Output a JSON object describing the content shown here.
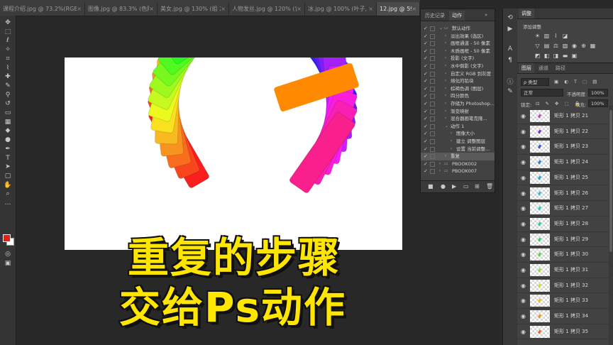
{
  "tabs": [
    {
      "label": "课程介绍.jpg @ 73.2%(RGB/...",
      "active": false
    },
    {
      "label": "图像.jpg @ 83.3% (色阶 1...",
      "active": false
    },
    {
      "label": "美女.jpg @ 130% (组 2, R...",
      "active": false
    },
    {
      "label": "人物发丝.jpg @ 120% (背景...",
      "active": false
    },
    {
      "label": "冰.jpg @ 100% (叶子, RGB...",
      "active": false
    },
    {
      "label": "12.jpg @ 59.6%",
      "active": true
    }
  ],
  "caption": {
    "line1": "重复的步骤",
    "line2": "交给Ps动作"
  },
  "actions_panel": {
    "tab_history": "历史记录",
    "tab_actions": "动作",
    "items": [
      {
        "label": "默认动作",
        "level": 0,
        "folder": true,
        "expanded": true
      },
      {
        "label": "淡出效果 (选区)",
        "level": 1
      },
      {
        "label": "画框通道 - 50 像素",
        "level": 1
      },
      {
        "label": "木质画框 - 50 像素",
        "level": 1
      },
      {
        "label": "投影 (文字)",
        "level": 1
      },
      {
        "label": "水中倒影 (文字)",
        "level": 1
      },
      {
        "label": "自定义 RGB 到灰度",
        "level": 1
      },
      {
        "label": "熔化的铅块",
        "level": 1
      },
      {
        "label": "棕褐色调 (图层)",
        "level": 1
      },
      {
        "label": "四分颜色",
        "level": 1
      },
      {
        "label": "存储为 Photoshop...",
        "level": 1
      },
      {
        "label": "渐变映射",
        "level": 1
      },
      {
        "label": "混合器画笔克隆...",
        "level": 1
      },
      {
        "label": "动作 1",
        "level": 1,
        "expanded": true
      },
      {
        "label": "图像大小",
        "level": 2
      },
      {
        "label": "建立 调整图层",
        "level": 2
      },
      {
        "label": "设置 当前调整...",
        "level": 2
      },
      {
        "label": "重复",
        "level": 1,
        "selected": true
      },
      {
        "label": "PBOOK002",
        "level": 0,
        "folder": true
      },
      {
        "label": "PBOOK007",
        "level": 0,
        "folder": true
      }
    ]
  },
  "adjustments": {
    "title": "调整",
    "subtitle": "添加调整"
  },
  "layers_panel": {
    "tabs": [
      "图层",
      "通道",
      "路径"
    ],
    "filter_label": "ρ 类型",
    "blend_mode": "正常",
    "opacity_label": "不透明度:",
    "opacity_value": "100%",
    "lock_label": "锁定:",
    "fill_label": "填充:",
    "fill_value": "100%",
    "layers": [
      {
        "name": "矩形 1 拷贝 21",
        "color": "#c040c0"
      },
      {
        "name": "矩形 1 拷贝 22",
        "color": "#7030d0"
      },
      {
        "name": "矩形 1 拷贝 23",
        "color": "#3050e0"
      },
      {
        "name": "矩形 1 拷贝 24",
        "color": "#2080e0"
      },
      {
        "name": "矩形 1 拷贝 25",
        "color": "#20a0e0"
      },
      {
        "name": "矩形 1 拷贝 26",
        "color": "#20c0e0"
      },
      {
        "name": "矩形 1 拷贝 27",
        "color": "#20d0c0"
      },
      {
        "name": "矩形 1 拷贝 28",
        "color": "#20d090"
      },
      {
        "name": "矩形 1 拷贝 29",
        "color": "#30d060"
      },
      {
        "name": "矩形 1 拷贝 30",
        "color": "#50d040"
      },
      {
        "name": "矩形 1 拷贝 31",
        "color": "#90e030"
      },
      {
        "name": "矩形 1 拷贝 32",
        "color": "#d0e020"
      },
      {
        "name": "矩形 1 拷贝 33",
        "color": "#f0c020"
      },
      {
        "name": "矩形 1 拷贝 34",
        "color": "#f09020"
      },
      {
        "name": "矩形 1 拷贝 35",
        "color": "#f06020"
      }
    ]
  }
}
